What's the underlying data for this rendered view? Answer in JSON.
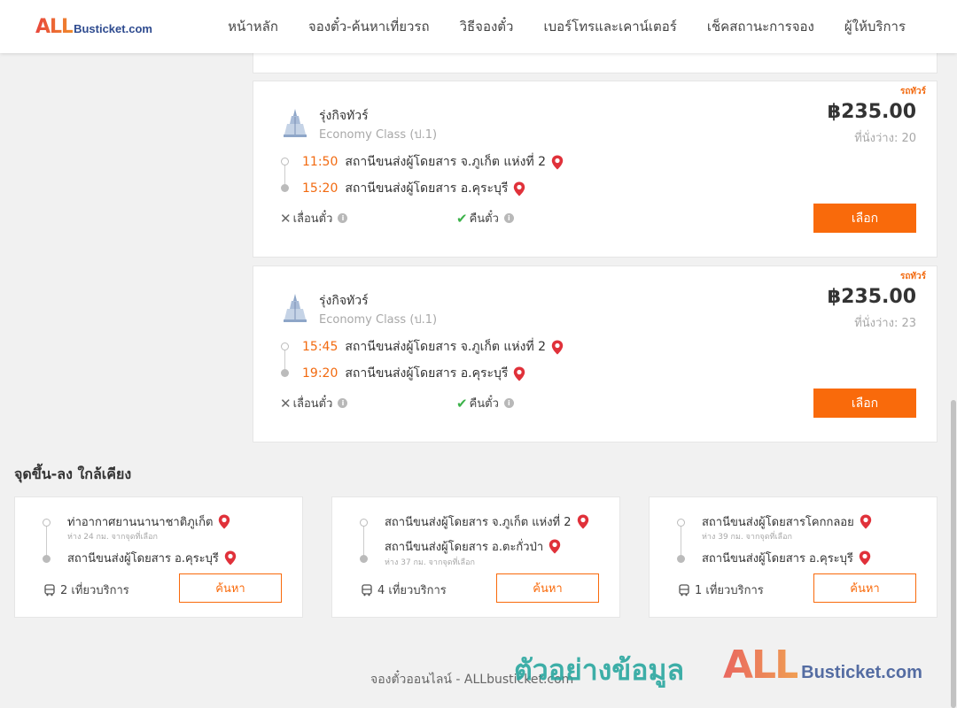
{
  "header": {
    "logo_all": "ALL",
    "logo_rest": "Busticket.com",
    "nav": [
      "หน้าหลัก",
      "จองตั๋ว-ค้นหาเที่ยวรถ",
      "วิธีจองตั๋ว",
      "เบอร์โทรและเคาน์เตอร์",
      "เช็คสถานะการจอง",
      "ผู้ให้บริการ"
    ]
  },
  "trips": [
    {
      "badge": "รถทัวร์",
      "operator": "รุ่งกิจทัวร์",
      "class": "Economy Class (ป.1)",
      "price": "฿235.00",
      "seats": "ที่นั่งว่าง: 20",
      "depart_time": "11:50",
      "depart_station": "สถานีขนส่งผู้โดยสาร จ.ภูเก็ต แห่งที่ 2",
      "arrive_time": "15:20",
      "arrive_station": "สถานีขนส่งผู้โดยสาร อ.คุระบุรี",
      "feature_reschedule": "เลื่อนตั๋ว",
      "feature_refund": "คืนตั๋ว",
      "select_label": "เลือก"
    },
    {
      "badge": "รถทัวร์",
      "operator": "รุ่งกิจทัวร์",
      "class": "Economy Class (ป.1)",
      "price": "฿235.00",
      "seats": "ที่นั่งว่าง: 23",
      "depart_time": "15:45",
      "depart_station": "สถานีขนส่งผู้โดยสาร จ.ภูเก็ต แห่งที่ 2",
      "arrive_time": "19:20",
      "arrive_station": "สถานีขนส่งผู้โดยสาร อ.คุระบุรี",
      "feature_reschedule": "เลื่อนตั๋ว",
      "feature_refund": "คืนตั๋ว",
      "select_label": "เลือก"
    }
  ],
  "nearby": {
    "title": "จุดขึ้น-ลง ใกล้เคียง",
    "items": [
      {
        "from": "ท่าอากาศยานนานาชาติภูเก็ต",
        "from_dist": "ห่าง 24 กม. จากจุดที่เลือก",
        "to": "สถานีขนส่งผู้โดยสาร อ.คุระบุรี",
        "to_dist": "",
        "trips": "2 เที่ยวบริการ",
        "search_label": "ค้นหา"
      },
      {
        "from": "สถานีขนส่งผู้โดยสาร จ.ภูเก็ต แห่งที่ 2",
        "from_dist": "",
        "to": "สถานีขนส่งผู้โดยสาร อ.ตะกั่วป่า",
        "to_dist": "ห่าง 37 กม. จากจุดที่เลือก",
        "trips": "4 เที่ยวบริการ",
        "search_label": "ค้นหา"
      },
      {
        "from": "สถานีขนส่งผู้โดยสารโคกกลอย",
        "from_dist": "ห่าง 39 กม. จากจุดที่เลือก",
        "to": "สถานีขนส่งผู้โดยสาร อ.คุระบุรี",
        "to_dist": "",
        "trips": "1 เที่ยวบริการ",
        "search_label": "ค้นหา"
      }
    ]
  },
  "footer": {
    "text": "จองตั๋วออนไลน์ - ALLbusticket.com",
    "watermark_text": "ตัวอย่างข้อมูล",
    "watermark_logo_all": "ALL",
    "watermark_logo_rest": "Busticket.com"
  },
  "colors": {
    "accent": "#f96a0b",
    "time": "#f26a10",
    "pin": "#e0313a",
    "check": "#3cb24a"
  }
}
